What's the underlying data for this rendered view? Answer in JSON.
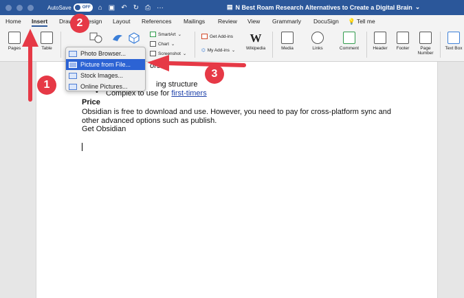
{
  "titlebar": {
    "autosave_label": "AutoSave",
    "autosave_state": "OFF",
    "document_title": "N Best Roam Research Alternatives to Create a Digital Brain"
  },
  "tabs": [
    "Home",
    "Insert",
    "Draw",
    "Design",
    "Layout",
    "References",
    "Mailings",
    "Review",
    "View",
    "Grammarly",
    "DocuSign",
    "Tell me"
  ],
  "active_tab": "Insert",
  "ribbon": {
    "pages": "Pages",
    "table": "Table",
    "smartart": "SmartArt",
    "chart": "Chart",
    "screenshot": "Screenshot",
    "get_addins": "Get Add-ins",
    "my_addins": "My Add-ins",
    "wikipedia": "Wikipedia",
    "media": "Media",
    "links": "Links",
    "comment": "Comment",
    "header": "Header",
    "footer": "Footer",
    "page_number": "Page Number",
    "text_box": "Text Box"
  },
  "dropdown": {
    "items": [
      "Photo Browser...",
      "Picture from File...",
      "Stock Images...",
      "Online Pictures..."
    ],
    "selected_index": 1
  },
  "document": {
    "partial_line_1": "ors",
    "partial_line_2": "ing structure",
    "bullet_text": "Complex to use for ",
    "bullet_link": "first-timers",
    "heading": "Price",
    "paragraph": "Obsidian is free to download and use. However, you need to pay for cross-platform sync and other advanced options such as publish.",
    "cta": "Get Obsidian"
  },
  "annotations": {
    "step1": "1",
    "step2": "2",
    "step3": "3",
    "color": "#e63946"
  }
}
